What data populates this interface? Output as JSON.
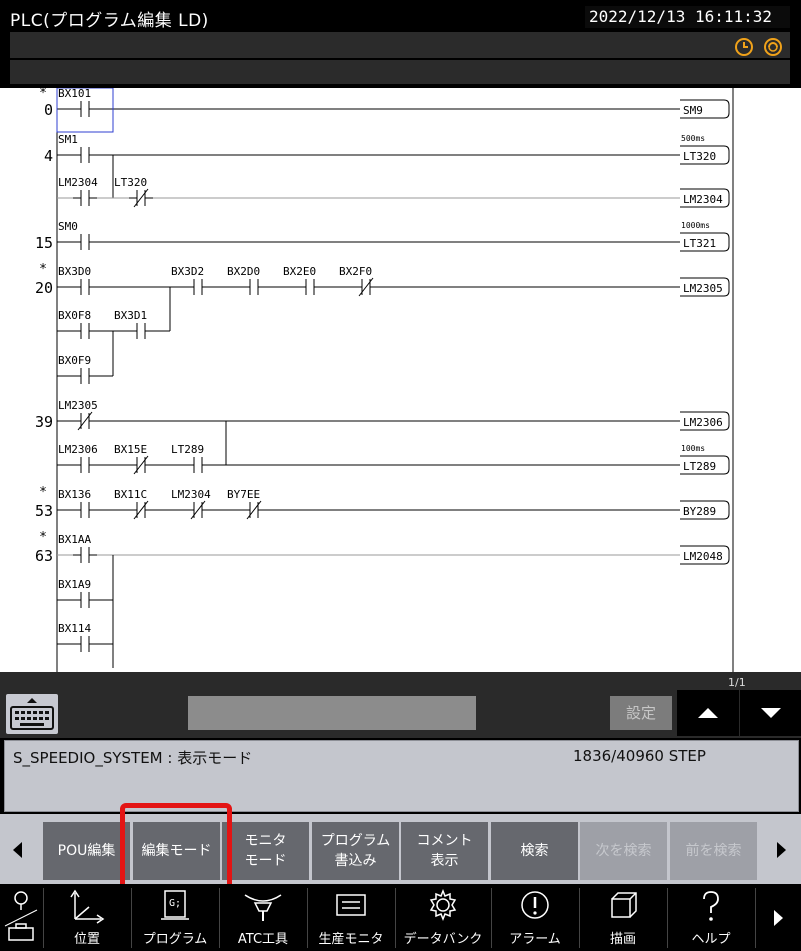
{
  "header": {
    "title": "PLC(プログラム編集 LD)",
    "datetime": "2022/12/13 16:11:32"
  },
  "ladder": {
    "step_numbers": [
      "0",
      "4",
      "15",
      "20",
      "39",
      "53",
      "63"
    ],
    "step_marks": [
      "*",
      "*",
      "*",
      "*"
    ],
    "contacts": [
      "BX101",
      "SM1",
      "LM2304",
      "LT320",
      "SM0",
      "BX3D0",
      "BX3D2",
      "BX2D0",
      "BX2E0",
      "BX2F0",
      "BX0F8",
      "BX3D1",
      "BX0F9",
      "LM2305",
      "LM2306",
      "BX15E",
      "LT289",
      "BX136",
      "BX11C",
      "LM2304",
      "BY7EE",
      "BX1AA",
      "BX1A9",
      "BX114"
    ],
    "coils": [
      "SM9",
      "LT320",
      "LM2304",
      "LT321",
      "LM2305",
      "LM2306",
      "LT289",
      "BY289",
      "LM2048"
    ],
    "timer_settings": [
      "500ms",
      "1000ms",
      "100ms"
    ]
  },
  "input": {
    "page_indicator": "1/1",
    "set_label": "設定"
  },
  "message": {
    "system_name": "S_SPEEDIO_SYSTEM : 表示モード",
    "step_count": "1836/40960 STEP"
  },
  "function_keys": [
    {
      "label": "POU編集"
    },
    {
      "label": "編集モード"
    },
    {
      "label": "モニタ\nモード"
    },
    {
      "label": "プログラム\n書込み"
    },
    {
      "label": "コメント\n表示"
    },
    {
      "label": "検索"
    },
    {
      "label": "次を検索"
    },
    {
      "label": "前を検索"
    }
  ],
  "nav": [
    {
      "label": ""
    },
    {
      "label": "位置"
    },
    {
      "label": "プログラム"
    },
    {
      "label": "ATC工具"
    },
    {
      "label": "生産モニタ"
    },
    {
      "label": "データバンク"
    },
    {
      "label": "アラーム"
    },
    {
      "label": "描画"
    },
    {
      "label": "ヘルプ"
    }
  ],
  "colors": {
    "accent": "#e31414",
    "header_icon": "#f0a21a",
    "ladder_line": "#000000",
    "cursor": "#2f3fd0"
  }
}
